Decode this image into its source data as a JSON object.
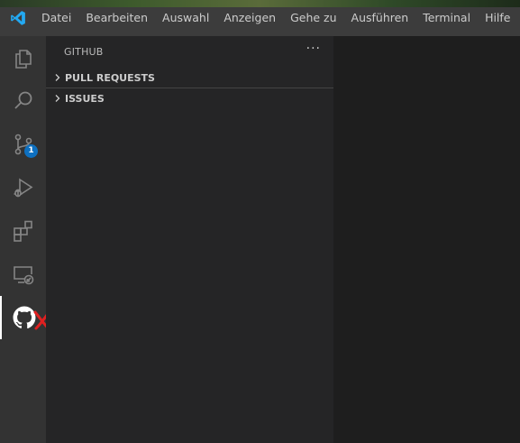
{
  "menubar": {
    "items": [
      "Datei",
      "Bearbeiten",
      "Auswahl",
      "Anzeigen",
      "Gehe zu",
      "Ausführen",
      "Terminal",
      "Hilfe"
    ]
  },
  "activitybar": {
    "items": [
      {
        "name": "explorer",
        "icon": "files-icon"
      },
      {
        "name": "search",
        "icon": "search-icon"
      },
      {
        "name": "source-control",
        "icon": "source-control-icon",
        "badge": "1"
      },
      {
        "name": "run-debug",
        "icon": "run-debug-icon"
      },
      {
        "name": "extensions",
        "icon": "extensions-icon"
      },
      {
        "name": "remote-explorer",
        "icon": "remote-explorer-icon"
      },
      {
        "name": "github",
        "icon": "github-icon",
        "active": true
      }
    ]
  },
  "sidebar": {
    "title": "GITHUB",
    "more_label": "···",
    "sections": [
      {
        "label": "PULL REQUESTS",
        "expanded": false
      },
      {
        "label": "ISSUES",
        "expanded": false
      }
    ]
  },
  "colors": {
    "titlebar": "#3c3c3c",
    "activitybar": "#333333",
    "sidebar": "#252526",
    "editor": "#1e1e1e",
    "badge": "#0e70c0",
    "annotation_x": "#e02020",
    "vscode_blue": "#23a9f2"
  }
}
